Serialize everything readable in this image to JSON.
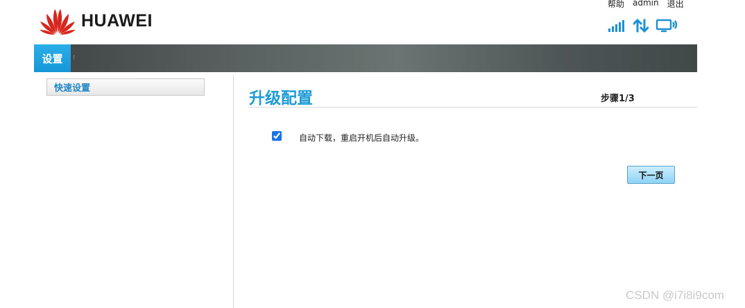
{
  "header": {
    "brand": "HUAWEI",
    "links": {
      "help": "帮助",
      "user": "admin",
      "logout": "退出"
    },
    "colors": {
      "logo_red": "#d7261d",
      "icon_blue": "#1e90d6"
    },
    "icons": [
      "signal-icon",
      "data-transfer-icon",
      "connected-pc-icon"
    ]
  },
  "nav": {
    "tabs": [
      {
        "label": "设置"
      }
    ],
    "accent": "#1a9fdd"
  },
  "sidebar": {
    "items": [
      {
        "label": "快速设置"
      }
    ]
  },
  "main": {
    "title": "升级配置",
    "step": "步骤1/3",
    "checkbox_label": "自动下载，重启开机后自动升级。",
    "checkbox_checked": true,
    "next_label": "下一页"
  },
  "watermark": "CSDN @i7i8i9com"
}
